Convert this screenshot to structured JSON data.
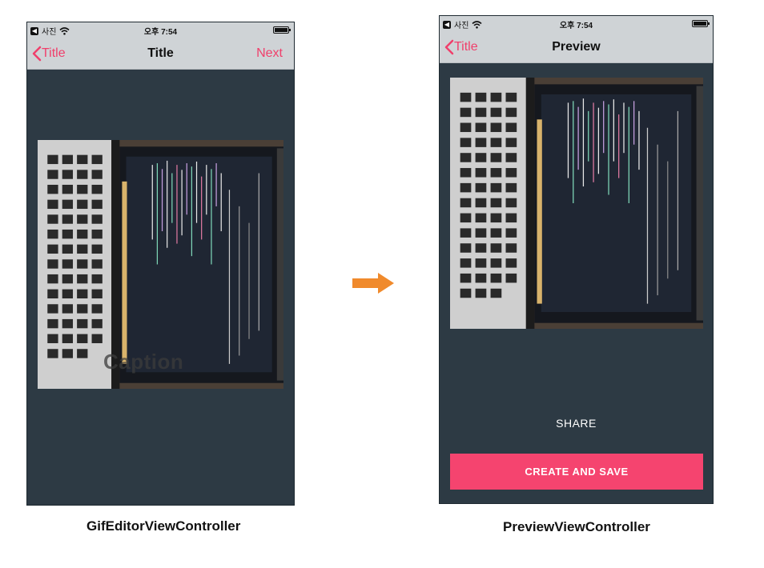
{
  "status_bar": {
    "app_back": "사진",
    "time": "오후 7:54"
  },
  "left_screen": {
    "nav": {
      "back_label": "Title",
      "title": "Title",
      "next_label": "Next"
    },
    "caption_placeholder": "Caption",
    "label": "GifEditorViewController"
  },
  "right_screen": {
    "nav": {
      "back_label": "Title",
      "title": "Preview"
    },
    "share_label": "SHARE",
    "create_save_label": "CREATE AND SAVE",
    "label": "PreviewViewController"
  },
  "colors": {
    "accent": "#f03f6b",
    "button": "#f5446f",
    "background": "#2d3a44",
    "arrow": "#f08a2c"
  },
  "icons": [
    "back-app-icon",
    "wifi-icon",
    "battery-icon",
    "chevron-left-icon",
    "arrow-right-icon"
  ]
}
